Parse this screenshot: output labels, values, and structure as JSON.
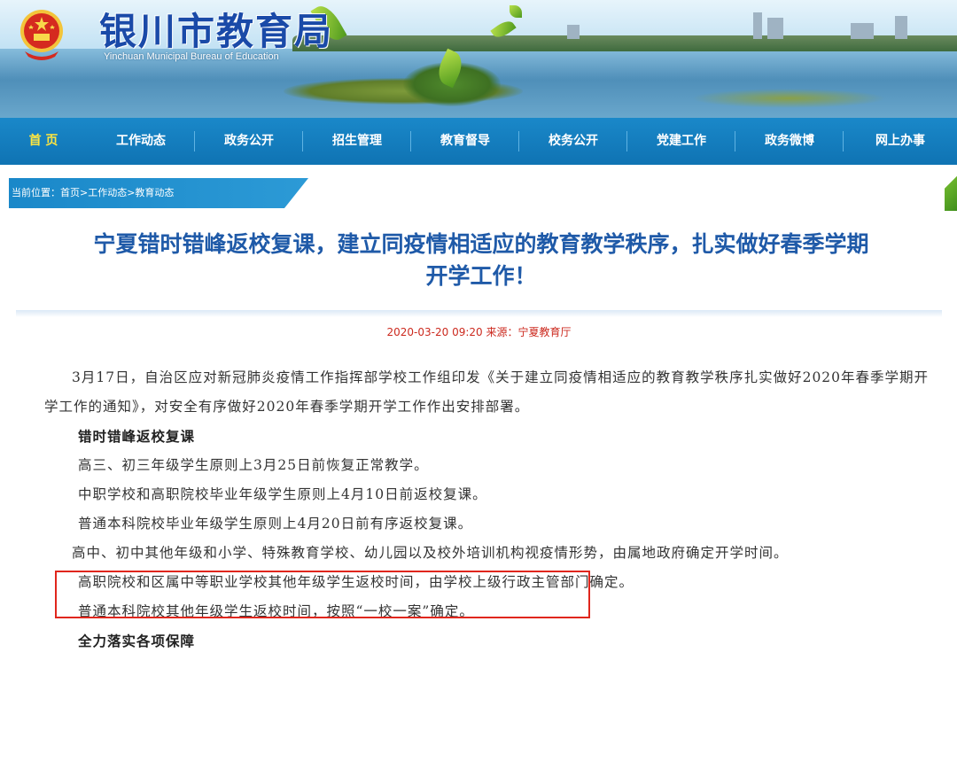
{
  "header": {
    "title": "银川市教育局",
    "subtitle_en": "Yinchuan Municipal Bureau of Education",
    "emblem_icon": "national-emblem-icon"
  },
  "nav": {
    "items": [
      "首 页",
      "工作动态",
      "政务公开",
      "招生管理",
      "教育督导",
      "校务公开",
      "党建工作",
      "政务微博",
      "网上办事"
    ],
    "active_index": 0
  },
  "breadcrumb": "当前位置：首页>工作动态>教育动态",
  "article": {
    "title_line1": "宁夏错时错峰返校复课，建立同疫情相适应的教育教学秩序，扎实做好春季学期",
    "title_line2": "开学工作！",
    "meta": "2020-03-20 09:20   来源：宁夏教育厅",
    "paragraphs": {
      "p1": "3月17日，自治区应对新冠肺炎疫情工作指挥部学校工作组印发《关于建立同疫情相适应的教育教学秩序扎实做好2020年春季学期开学工作的通知》，对安全有序做好2020年春季学期开学工作作出安排部署。",
      "h1": "错时错峰返校复课",
      "p2": "高三、初三年级学生原则上3月25日前恢复正常教学。",
      "p3": "中职学校和高职院校毕业年级学生原则上4月10日前返校复课。",
      "p4": "普通本科院校毕业年级学生原则上4月20日前有序返校复课。",
      "p5": "高中、初中其他年级和小学、特殊教育学校、幼儿园以及校外培训机构视疫情形势，由属地政府确定开学时间。",
      "p6": "高职院校和区属中等职业学校其他年级学生返校时间，由学校上级行政主管部门确定。",
      "p7": "普通本科院校其他年级学生返校时间，按照“一校一案”确定。",
      "h2": "全力落实各项保障"
    }
  },
  "colors": {
    "nav_bg": "#1a88c9",
    "nav_active": "#ffe640",
    "title": "#1f5aa8",
    "meta": "#cc2a1f",
    "highlight_box": "#e0261c"
  }
}
